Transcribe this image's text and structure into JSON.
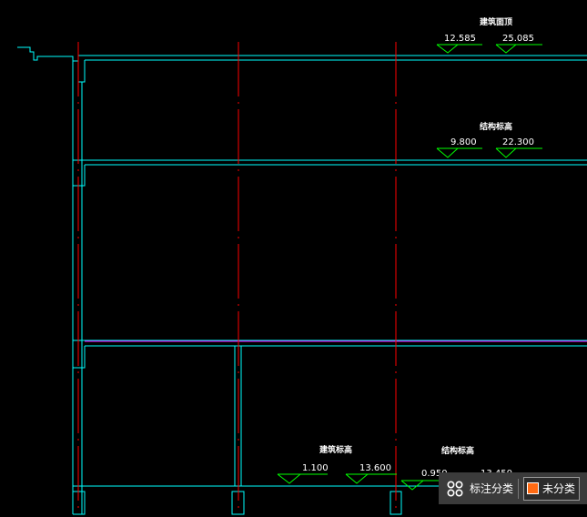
{
  "drawing": {
    "colors": {
      "wall": "#00ffff",
      "axis": "#ff0000",
      "mark": "#00ff00",
      "slab_line": "#ff00ff",
      "text": "#ffffff"
    },
    "roof_level": {
      "title": "建筑面顶",
      "left_value": "12.585",
      "right_value": "25.085"
    },
    "second_level": {
      "title": "结构标高",
      "left_value": "9.800",
      "right_value": "22.300"
    },
    "bottom_arch": {
      "title": "建筑标高",
      "left_value": "1.100",
      "right_value": "13.600"
    },
    "bottom_struct": {
      "title": "结构标高",
      "left_value": "0.950",
      "right_value": "13.450"
    }
  },
  "toolbar": {
    "icon": "grid-settings-icon",
    "label": "标注分类",
    "category_label": "未分类",
    "category_color": "#ff6a13"
  }
}
